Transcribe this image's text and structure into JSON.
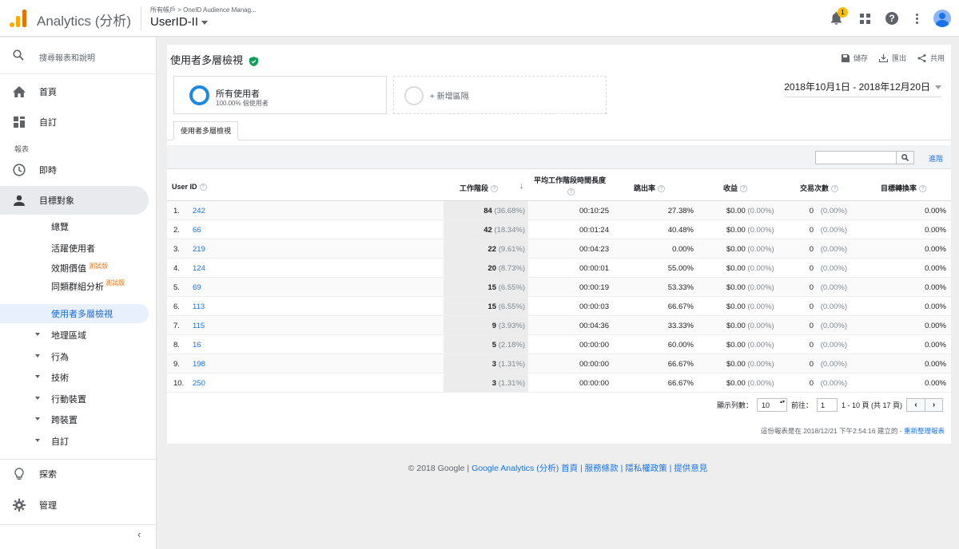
{
  "app": {
    "title": "Analytics (分析)"
  },
  "header": {
    "breadcrumb": "所有帳戶 > OneID Audience Manag...",
    "view": "UserID-II",
    "notification_count": "1"
  },
  "sidebar": {
    "search": "搜尋報表和說明",
    "home": "首頁",
    "custom": "自訂",
    "reports_heading": "報表",
    "realtime": "即時",
    "audience": "目標對象",
    "sub": {
      "overview": "總覽",
      "active_users": "活躍使用者",
      "lifetime_value": "效期價值",
      "lifetime_value_badge": "測試版",
      "cohort": "同類群組分析",
      "cohort_badge": "測試版",
      "user_explorer": "使用者多層檢視",
      "geo": "地理區域",
      "behavior": "行為",
      "technology": "技術",
      "mobile": "行動裝置",
      "cross_device": "跨裝置",
      "custom": "自訂"
    },
    "discover": "探索",
    "admin": "管理"
  },
  "main": {
    "title": "使用者多層檢視",
    "actions": {
      "save": "儲存",
      "export": "匯出",
      "share": "共用"
    },
    "segment": {
      "name": "所有使用者",
      "sub": "100.00% 個使用者"
    },
    "add_segment": "+ 新增區隔",
    "date_range": "2018年10月1日 - 2018年12月20日",
    "tab": "使用者多層檢視",
    "advanced": "進階"
  },
  "table": {
    "headers": {
      "user_id": "User ID",
      "sessions": "工作階段",
      "avg_duration": "平均工作階段時間長度",
      "bounce_rate": "跳出率",
      "revenue": "收益",
      "transactions": "交易次數",
      "conversion": "目標轉換率"
    },
    "rows": [
      {
        "num": "1.",
        "id": "242",
        "sessions": "84",
        "sess_pct": "(36.68%)",
        "duration": "00:10:25",
        "bounce": "27.38%",
        "revenue": "$0.00",
        "rev_pct": "(0.00%)",
        "trans": "0",
        "trans_pct": "(0.00%)",
        "conv": "0.00%"
      },
      {
        "num": "2.",
        "id": "66",
        "sessions": "42",
        "sess_pct": "(18.34%)",
        "duration": "00:01:24",
        "bounce": "40.48%",
        "revenue": "$0.00",
        "rev_pct": "(0.00%)",
        "trans": "0",
        "trans_pct": "(0.00%)",
        "conv": "0.00%"
      },
      {
        "num": "3.",
        "id": "219",
        "sessions": "22",
        "sess_pct": "(9.61%)",
        "duration": "00:04:23",
        "bounce": "0.00%",
        "revenue": "$0.00",
        "rev_pct": "(0.00%)",
        "trans": "0",
        "trans_pct": "(0.00%)",
        "conv": "0.00%"
      },
      {
        "num": "4.",
        "id": "124",
        "sessions": "20",
        "sess_pct": "(8.73%)",
        "duration": "00:00:01",
        "bounce": "55.00%",
        "revenue": "$0.00",
        "rev_pct": "(0.00%)",
        "trans": "0",
        "trans_pct": "(0.00%)",
        "conv": "0.00%"
      },
      {
        "num": "5.",
        "id": "69",
        "sessions": "15",
        "sess_pct": "(6.55%)",
        "duration": "00:00:19",
        "bounce": "53.33%",
        "revenue": "$0.00",
        "rev_pct": "(0.00%)",
        "trans": "0",
        "trans_pct": "(0.00%)",
        "conv": "0.00%"
      },
      {
        "num": "6.",
        "id": "113",
        "sessions": "15",
        "sess_pct": "(6.55%)",
        "duration": "00:00:03",
        "bounce": "66.67%",
        "revenue": "$0.00",
        "rev_pct": "(0.00%)",
        "trans": "0",
        "trans_pct": "(0.00%)",
        "conv": "0.00%"
      },
      {
        "num": "7.",
        "id": "115",
        "sessions": "9",
        "sess_pct": "(3.93%)",
        "duration": "00:04:36",
        "bounce": "33.33%",
        "revenue": "$0.00",
        "rev_pct": "(0.00%)",
        "trans": "0",
        "trans_pct": "(0.00%)",
        "conv": "0.00%"
      },
      {
        "num": "8.",
        "id": "16",
        "sessions": "5",
        "sess_pct": "(2.18%)",
        "duration": "00:00:00",
        "bounce": "60.00%",
        "revenue": "$0.00",
        "rev_pct": "(0.00%)",
        "trans": "0",
        "trans_pct": "(0.00%)",
        "conv": "0.00%"
      },
      {
        "num": "9.",
        "id": "198",
        "sessions": "3",
        "sess_pct": "(1.31%)",
        "duration": "00:00:00",
        "bounce": "66.67%",
        "revenue": "$0.00",
        "rev_pct": "(0.00%)",
        "trans": "0",
        "trans_pct": "(0.00%)",
        "conv": "0.00%"
      },
      {
        "num": "10.",
        "id": "250",
        "sessions": "3",
        "sess_pct": "(1.31%)",
        "duration": "00:00:00",
        "bounce": "66.67%",
        "revenue": "$0.00",
        "rev_pct": "(0.00%)",
        "trans": "0",
        "trans_pct": "(0.00%)",
        "conv": "0.00%"
      }
    ]
  },
  "pager": {
    "show_rows_label": "顯示列數：",
    "show_rows_value": "10",
    "goto_label": "前往：",
    "goto_value": "1",
    "range": "1 - 10 頁 (共 17 頁)"
  },
  "created": {
    "text": "這份報表是在 2018/12/21 下午2:54:16 建立的 -",
    "refresh": "重新整理報表"
  },
  "footer": {
    "copyright": "© 2018 Google",
    "links": "Google Analytics (分析) 首頁 | 服務條款 | 隱私權政策 | 提供意見"
  },
  "colors": {
    "accent": "#1a73e8",
    "badge": "#fbbc04",
    "beta": "#e8710a",
    "verified": "#0f9d58"
  }
}
